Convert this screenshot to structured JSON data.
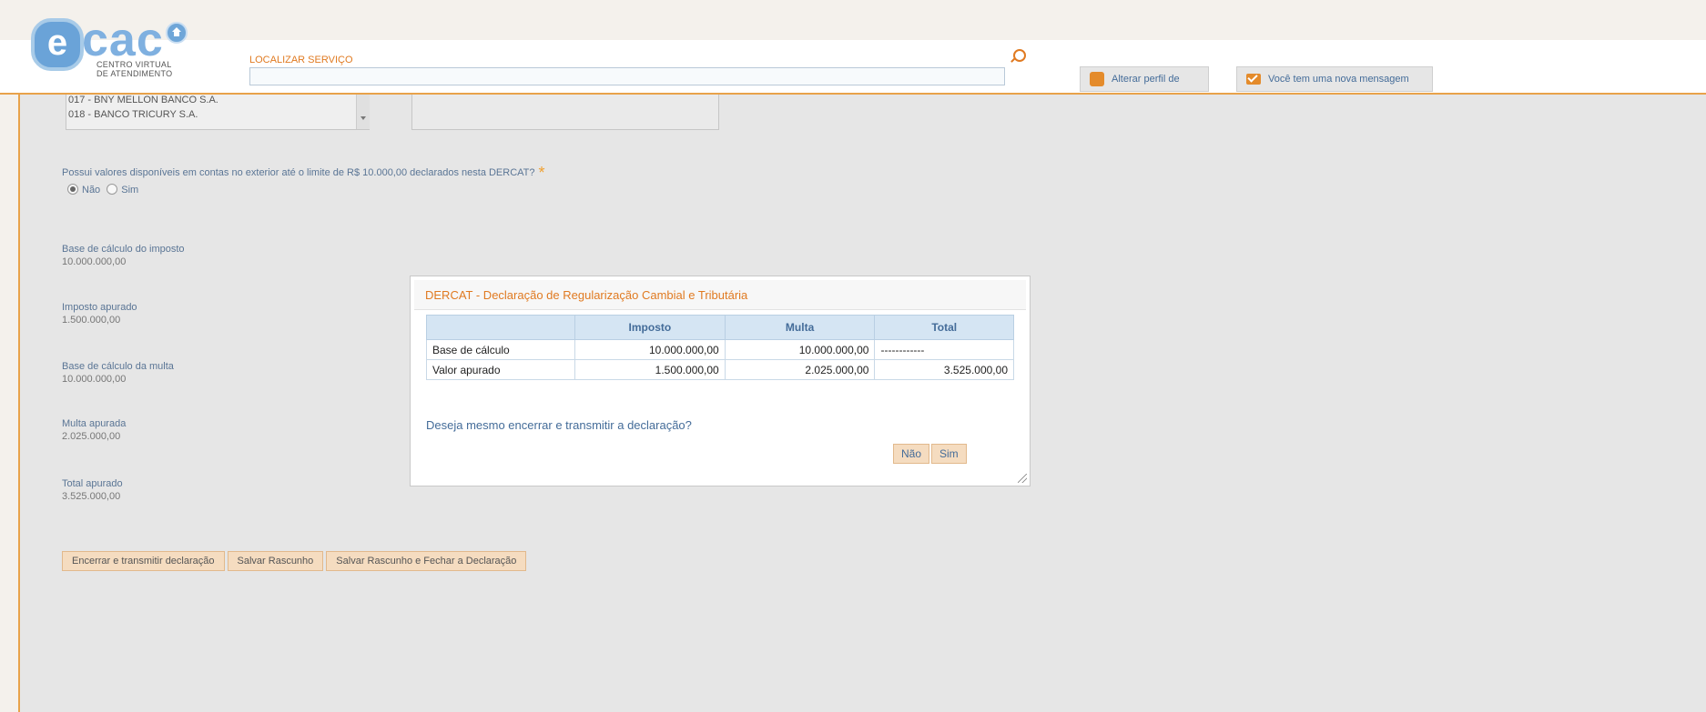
{
  "header": {
    "logo_letter": "e",
    "logo_text": "cac",
    "logo_sub1": "CENTRO VIRTUAL",
    "logo_sub2": "DE ATENDIMENTO",
    "search_label": "LOCALIZAR SERVIÇO",
    "search_value": "",
    "profile_button": "Alterar perfil de acesso",
    "message_button": "Você tem uma nova mensagem"
  },
  "banks": [
    "017 - BNY MELLON BANCO S.A.",
    "018 - BANCO TRICURY S.A."
  ],
  "form": {
    "question": "Possui valores disponíveis em contas no exterior até o limite de R$ 10.000,00 declarados nesta DERCAT?",
    "required_mark": "*",
    "radio_no": "Não",
    "radio_yes": "Sim",
    "selected": "Não",
    "fields": [
      {
        "label": "Base de cálculo do imposto",
        "value": "10.000.000,00"
      },
      {
        "label": "Imposto apurado",
        "value": "1.500.000,00"
      },
      {
        "label": "Base de cálculo da multa",
        "value": "10.000.000,00"
      },
      {
        "label": "Multa apurada",
        "value": "2.025.000,00"
      },
      {
        "label": "Total apurado",
        "value": "3.525.000,00"
      }
    ],
    "buttons": {
      "submit": "Encerrar e transmitir declaração",
      "save_draft": "Salvar Rascunho",
      "save_close": "Salvar Rascunho e Fechar a Declaração"
    }
  },
  "dialog": {
    "title": "DERCAT - Declaração de Regularização Cambial e Tributária",
    "columns": [
      "",
      "Imposto",
      "Multa",
      "Total"
    ],
    "rows": [
      [
        "Base de cálculo",
        "10.000.000,00",
        "10.000.000,00",
        "------------"
      ],
      [
        "Valor apurado",
        "1.500.000,00",
        "2.025.000,00",
        "3.525.000,00"
      ]
    ],
    "question": "Deseja mesmo encerrar e transmitir a declaração?",
    "no_button": "Não",
    "yes_button": "Sim"
  }
}
